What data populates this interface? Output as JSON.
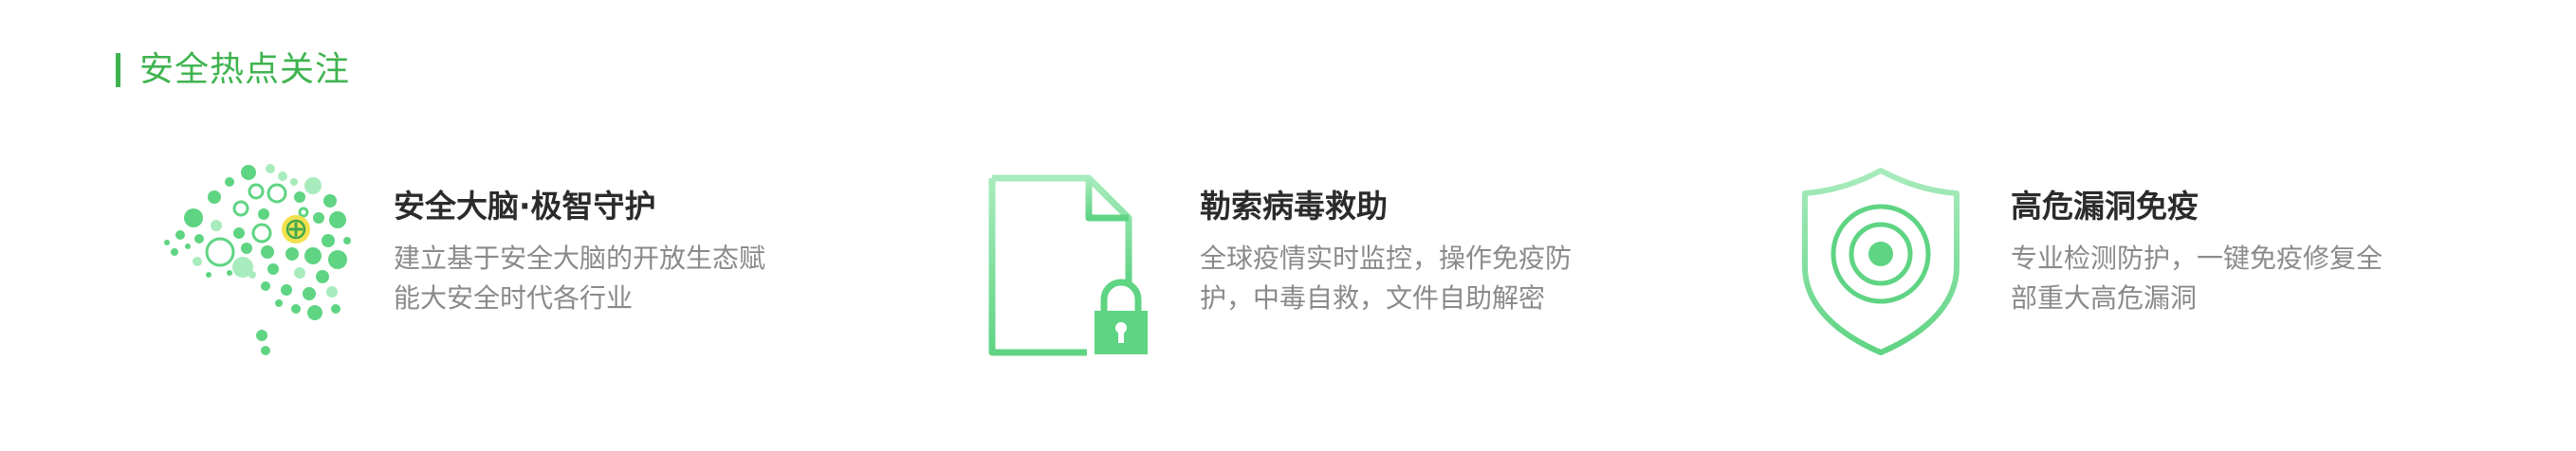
{
  "section": {
    "title": "安全热点关注",
    "accent_color": "#3fb34f"
  },
  "features": [
    {
      "title": "安全大脑·极智守护",
      "desc_line1": "建立基于安全大脑的开放生态赋",
      "desc_line2": "能大安全时代各行业",
      "icon": "brain-network-icon"
    },
    {
      "title": "勒索病毒救助",
      "desc_line1": "全球疫情实时监控，操作免疫防",
      "desc_line2": "护，中毒自救，文件自助解密",
      "icon": "locked-document-icon"
    },
    {
      "title": "高危漏洞免疫",
      "desc_line1": "专业检测防护，一键免疫修复全",
      "desc_line2": "部重大高危漏洞",
      "icon": "shield-target-icon"
    }
  ],
  "colors": {
    "icon_green": "#5fd483",
    "icon_green_light": "#a8ebbd",
    "badge_yellow": "#f2e14c",
    "title_text": "#2b2b2b",
    "desc_text": "#8a8a8a"
  }
}
